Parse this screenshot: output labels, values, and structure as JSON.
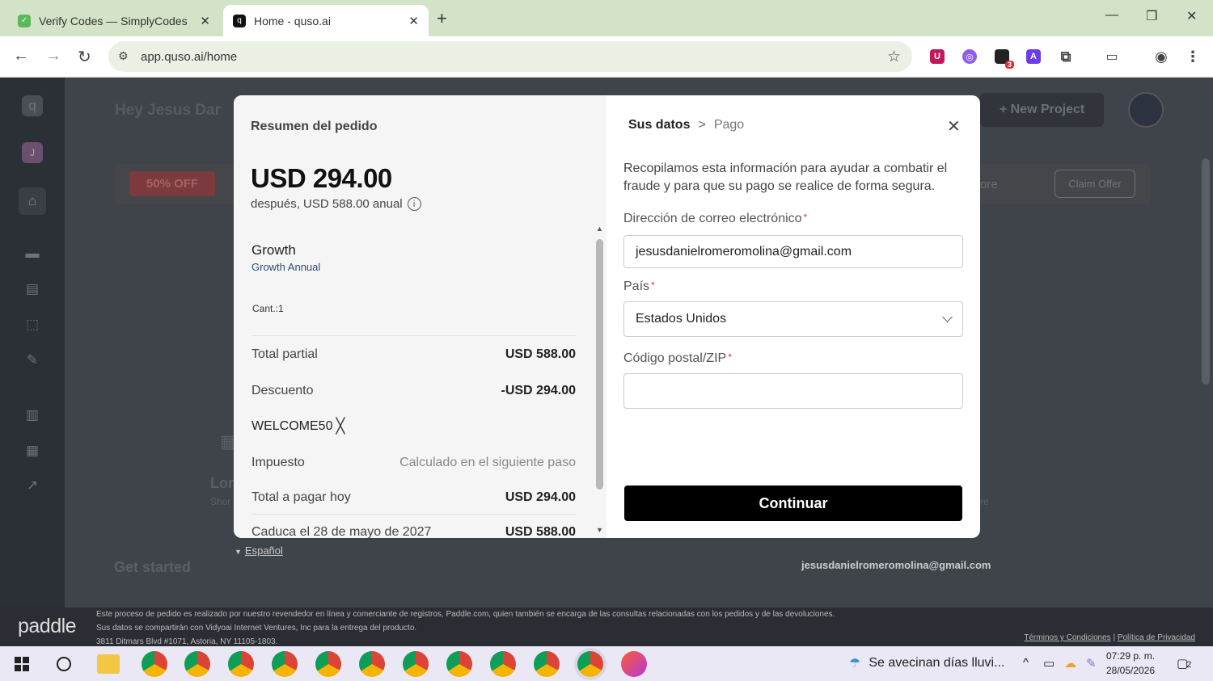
{
  "browser": {
    "tabs": [
      {
        "title": "Verify Codes — SimplyCodes",
        "active": false
      },
      {
        "title": "Home - quso.ai",
        "active": true
      }
    ],
    "url": "app.quso.ai/home"
  },
  "app": {
    "greeting": "Hey Jesus Dar",
    "new_project": "+ New Project",
    "promo_badge": "50% OFF",
    "promo_link_right": "ore",
    "claim_offer": "Claim Offer",
    "get_started": "Get started",
    "card_title": "Lon",
    "card_sub": "Shor",
    "card_right": "re"
  },
  "modal": {
    "summary_title": "Resumen del pedido",
    "price": "USD 294.00",
    "after": "después, USD 588.00 anual",
    "plan_name": "Growth",
    "plan_sub": "Growth Annual",
    "qty": "Cant.:1",
    "rows": [
      {
        "label": "Total partial",
        "value": "USD 588.00"
      },
      {
        "label": "Descuento",
        "value": "-USD 294.00"
      },
      {
        "label": "Impuesto",
        "value": "Calculado en el siguiente paso"
      },
      {
        "label": "Total a pagar hoy",
        "value": "USD 294.00"
      },
      {
        "label": "Caduca el 28 de mayo de 2027",
        "value": "USD 588.00"
      }
    ],
    "coupon": "WELCOME50",
    "breadcrumb": {
      "current": "Sus datos",
      "sep": ">",
      "next": "Pago"
    },
    "description": "Recopilamos esta información para ayudar a combatir el fraude y para que su pago se realice de forma segura.",
    "email_label": "Dirección de correo electrónico",
    "email_value": "jesusdanielromeromolina@gmail.com",
    "country_label": "País",
    "country_value": "Estados Unidos",
    "zip_label": "Código postal/ZIP",
    "zip_value": "",
    "continue": "Continuar",
    "required_mark": "*"
  },
  "below_modal": {
    "language": "Español",
    "email": "jesusdanielromeromolina@gmail.com"
  },
  "paddle": {
    "logo": "paddle",
    "line1": "Este proceso de pedido es realizado por nuestro revendedor en línea y comerciante de registros, Paddle.com, quien también se encarga de las consultas relacionadas con los pedidos y de las devoluciones.",
    "line2": "Sus datos se compartirán con Vidyoai Internet Ventures, Inc para la entrega del producto.",
    "line3": "3811 Ditmars Blvd #1071, Astoria, NY 11105-1803.",
    "terms": "Términos y Condiciones",
    "privacy": "Política de Privacidad",
    "link_sep": "|"
  },
  "taskbar": {
    "weather": "Se avecinan días lluvi...",
    "time": "07:29 p. m.",
    "date": "28/05/2026",
    "notif_count": "2"
  },
  "extensions": {
    "badge_count": "3"
  },
  "colors": {
    "accent_black": "#000000",
    "required_red": "#dd3333",
    "tab_bar": "#d3e3c8"
  }
}
